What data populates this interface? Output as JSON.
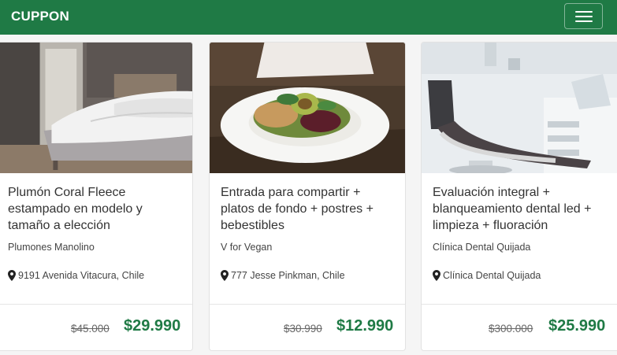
{
  "navbar": {
    "brand": "CUPPON",
    "menu_icon": "hamburger-menu-icon"
  },
  "deals": [
    {
      "title": "Plumón Coral Fleece estampado en modelo y tamaño a elección",
      "merchant": "Plumones Manolino",
      "location": "9191 Avenida Vitacura, Chile",
      "old_price": "$45.000",
      "price": "$29.990",
      "image": "bed-photo"
    },
    {
      "title": "Entrada para compartir + platos de fondo + postres + bebestibles",
      "merchant": "V for Vegan",
      "location": "777 Jesse Pinkman, Chile",
      "old_price": "$30.990",
      "price": "$12.990",
      "image": "vegan-salad-photo"
    },
    {
      "title": "Evaluación integral + blanqueamiento dental led + limpieza + fluoración",
      "merchant": "Clínica Dental Quijada",
      "location": "Clínica Dental Quijada",
      "old_price": "$300.000",
      "price": "$25.990",
      "image": "dental-chair-photo"
    }
  ],
  "colors": {
    "brand_green": "#1f7a45",
    "price_green": "#1f7a45"
  }
}
